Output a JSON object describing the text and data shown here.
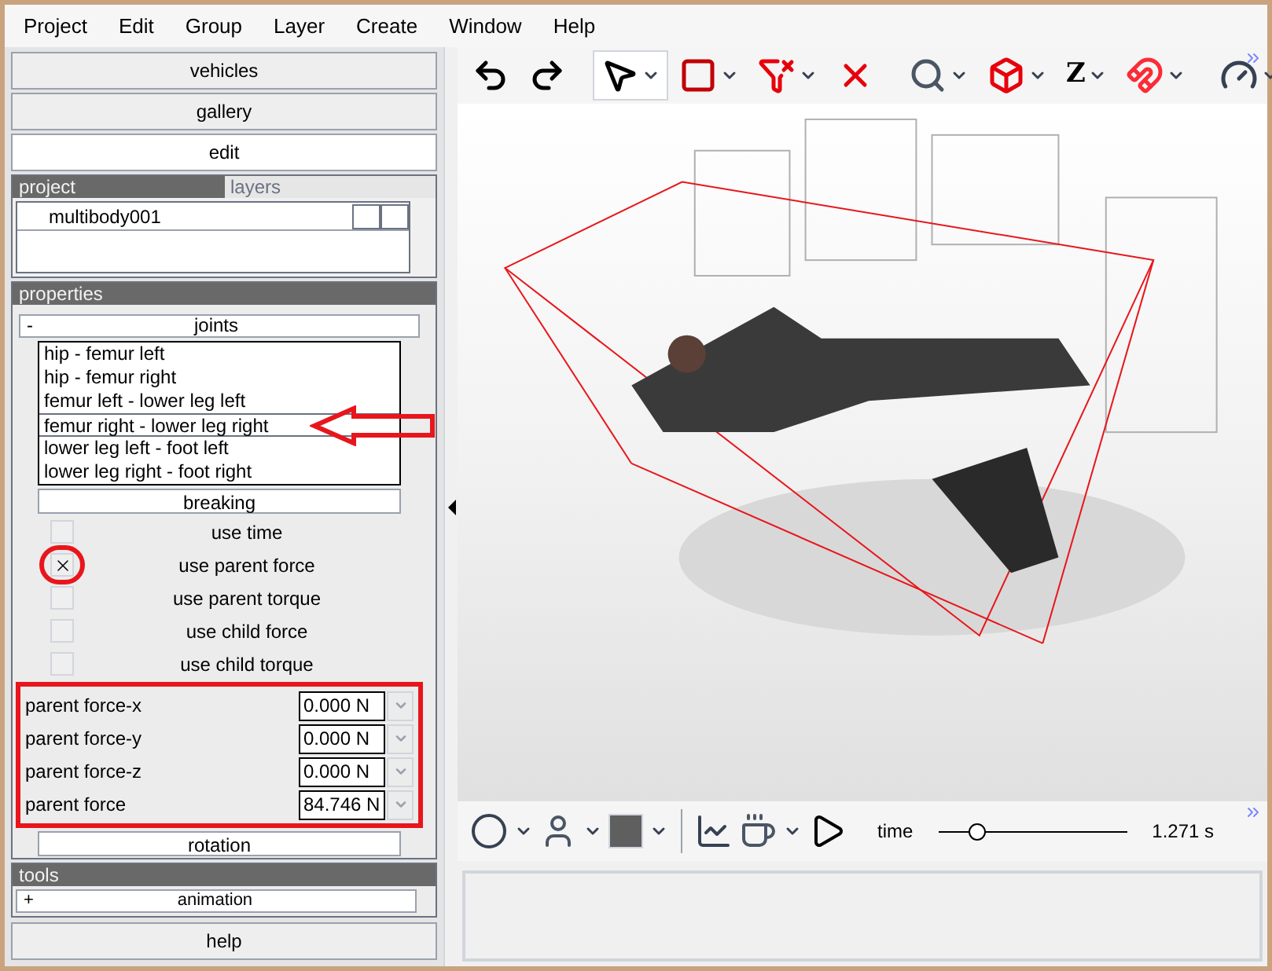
{
  "menu": [
    "Project",
    "Edit",
    "Group",
    "Layer",
    "Create",
    "Window",
    "Help"
  ],
  "nav_buttons": [
    {
      "label": "vehicles",
      "selected": false
    },
    {
      "label": "gallery",
      "selected": false
    },
    {
      "label": "edit",
      "selected": true
    }
  ],
  "project_tabs": [
    {
      "label": "project",
      "selected": true
    },
    {
      "label": "layers",
      "selected": false
    }
  ],
  "project_items": [
    "multibody001"
  ],
  "properties": {
    "title": "properties",
    "section": {
      "toggle": "-",
      "title": "joints"
    },
    "joints": [
      {
        "label": "hip - femur left",
        "selected": false,
        "pointed": false
      },
      {
        "label": "hip - femur right",
        "selected": false,
        "pointed": false
      },
      {
        "label": "femur left - lower leg left",
        "selected": false,
        "pointed": false
      },
      {
        "label": "femur right - lower leg right",
        "selected": true,
        "pointed": true
      },
      {
        "label": "lower leg left - foot left",
        "selected": false,
        "pointed": false
      },
      {
        "label": "lower leg right - foot right",
        "selected": false,
        "pointed": false
      }
    ],
    "breaking": "breaking",
    "options": [
      {
        "label": "use time",
        "checked": false,
        "circled": false
      },
      {
        "label": "use parent force",
        "checked": true,
        "circled": true
      },
      {
        "label": "use parent torque",
        "checked": false,
        "circled": false
      },
      {
        "label": "use child force",
        "checked": false,
        "circled": false
      },
      {
        "label": "use child torque",
        "checked": false,
        "circled": false
      }
    ],
    "forces_highlighted": true,
    "forces": [
      {
        "label": "parent force-x",
        "value": "0.000 N"
      },
      {
        "label": "parent force-y",
        "value": "0.000 N"
      },
      {
        "label": "parent force-z",
        "value": "0.000 N"
      },
      {
        "label": "parent force",
        "value": "84.746 N"
      }
    ],
    "rotation": "rotation"
  },
  "tools": {
    "title": "tools",
    "section": {
      "toggle": "+",
      "title": "animation"
    }
  },
  "help": "help",
  "toolbar": [
    {
      "kind": "undo",
      "selected": false
    },
    {
      "kind": "redo",
      "selected": false
    },
    {
      "kind": "separator"
    },
    {
      "kind": "pointer",
      "selected": true
    },
    {
      "kind": "rect-select",
      "selected": false
    },
    {
      "kind": "funnel-off",
      "selected": false
    },
    {
      "kind": "delete",
      "selected": false
    },
    {
      "kind": "separator"
    },
    {
      "kind": "zoom",
      "selected": false
    },
    {
      "kind": "cube",
      "selected": false
    },
    {
      "kind": "text",
      "label": "Z",
      "selected": false
    },
    {
      "kind": "magnet",
      "selected": false
    },
    {
      "kind": "separator"
    },
    {
      "kind": "gauge",
      "selected": false
    }
  ],
  "bottom_toolbar": {
    "time_label": "time",
    "time": {
      "level": 0.2
    },
    "time_value": "1.271 s"
  }
}
